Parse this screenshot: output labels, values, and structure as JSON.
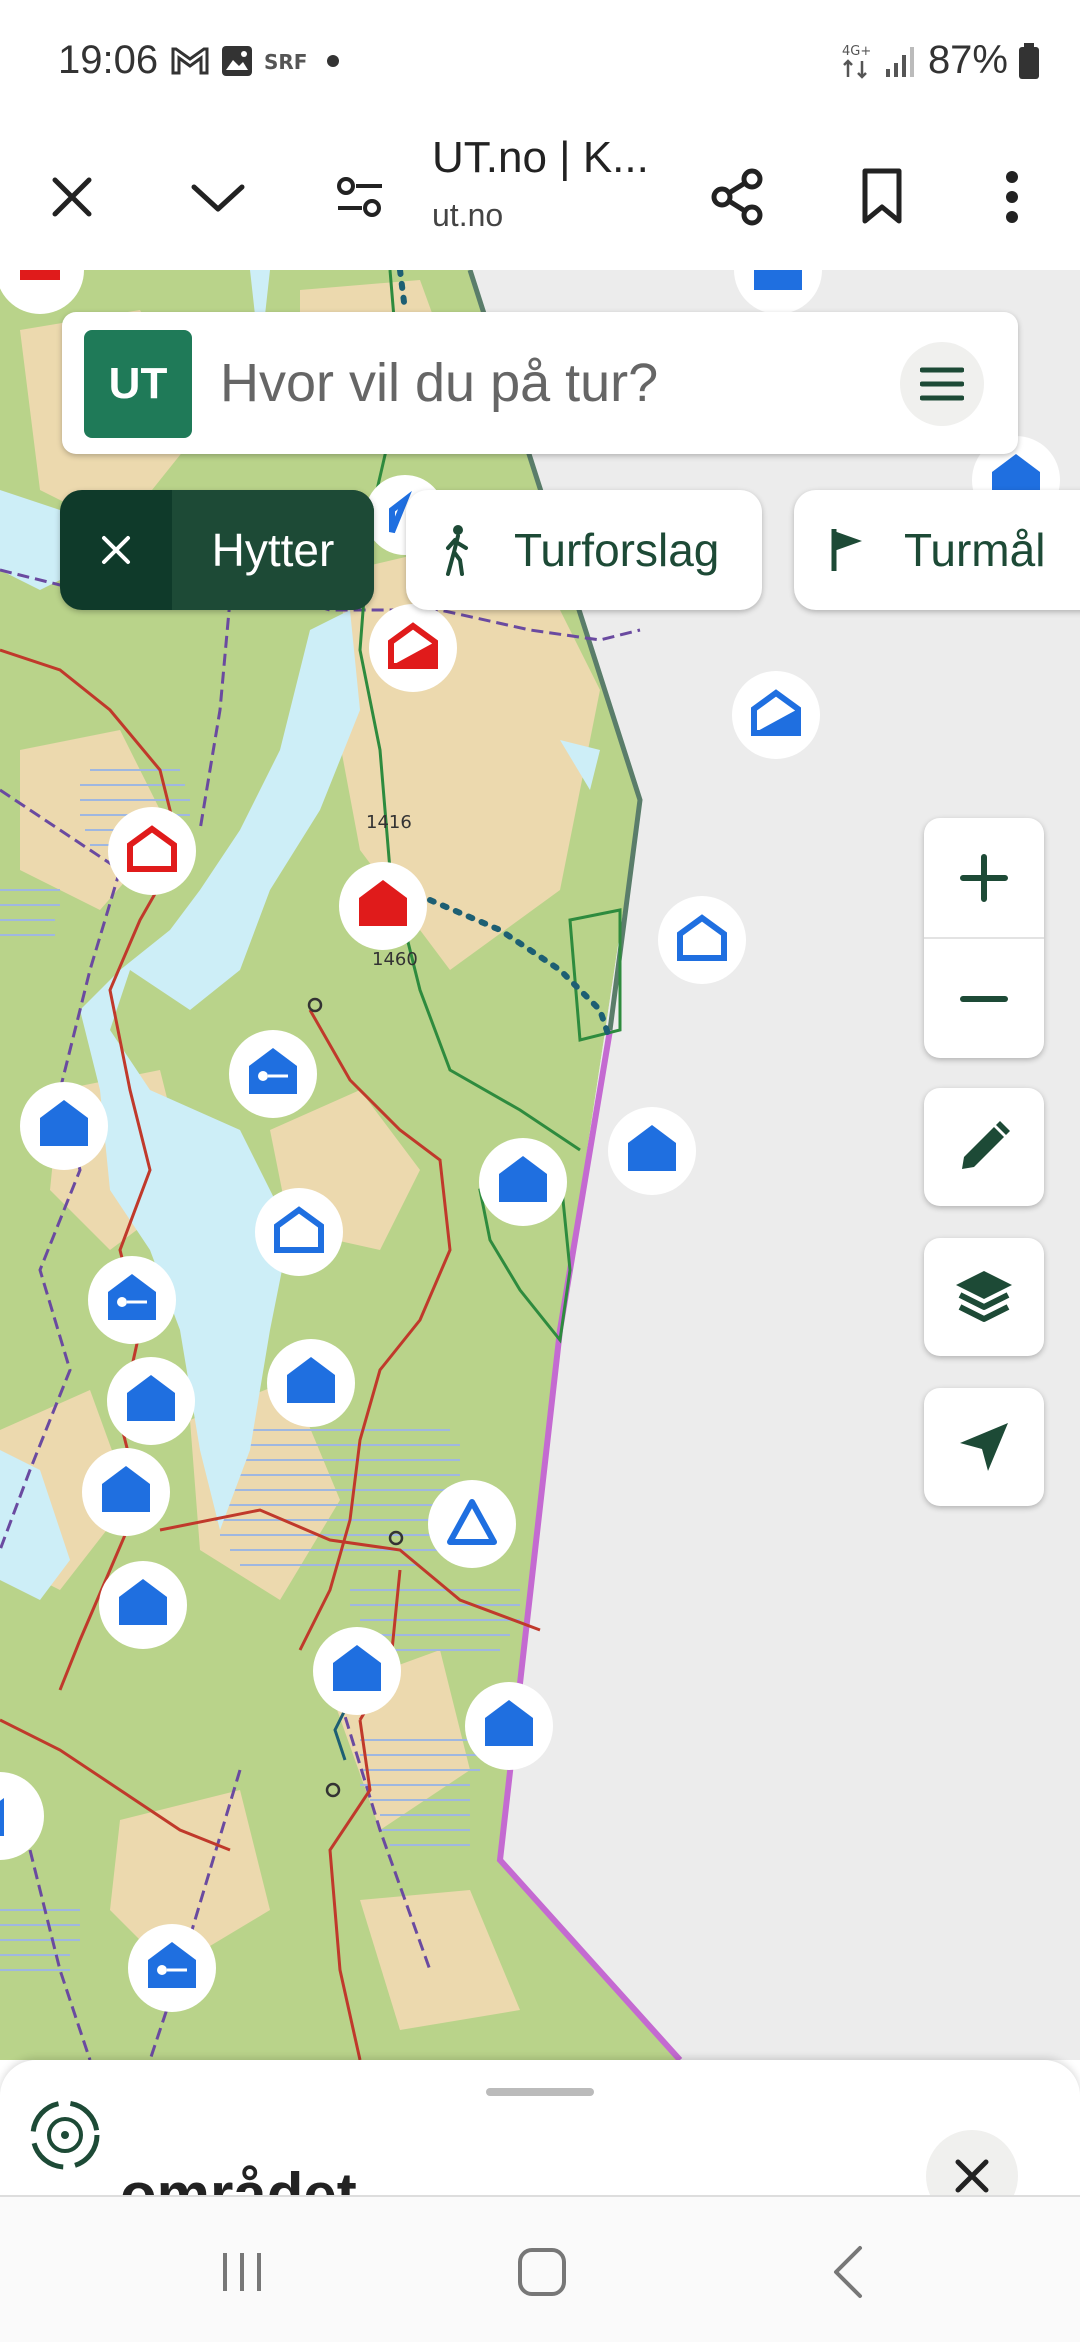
{
  "status_bar": {
    "time": "19:06",
    "network": "4G+",
    "battery": "87%"
  },
  "browser": {
    "title": "UT.no | K...",
    "url": "ut.no"
  },
  "search": {
    "logo": "UT",
    "placeholder": "Hvor vil du på tur?"
  },
  "filters": [
    {
      "label": "Hytter",
      "active": true,
      "icon": "close-icon"
    },
    {
      "label": "Turforslag",
      "active": false,
      "icon": "hiker-icon"
    },
    {
      "label": "Turmål",
      "active": false,
      "icon": "flag-icon"
    }
  ],
  "map": {
    "elevations": [
      "1416",
      "1460"
    ],
    "controls": [
      "zoom-in",
      "zoom-out",
      "draw",
      "layers",
      "locate"
    ],
    "colors": {
      "water": "#cdeef7",
      "forest": "#b9d38a",
      "terrain": "#ecd9ae",
      "boundary": "#c46ad1",
      "marker_blue": "#1f6fe0",
      "marker_red": "#e01b1b"
    }
  },
  "bottom_sheet": {
    "title": "området"
  }
}
